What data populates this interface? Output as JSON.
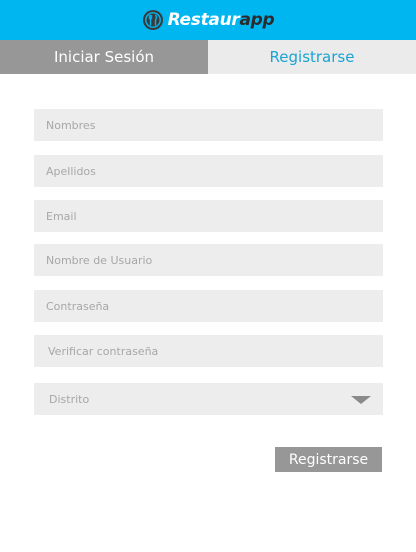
{
  "header": {
    "logo_part1": "Restaur",
    "logo_part2": "app",
    "background_color": "#00b6f1",
    "logo_icon": "fork-knife-plate-icon"
  },
  "tabs": [
    {
      "label": "Iniciar Sesión",
      "active": false
    },
    {
      "label": "Registrarse",
      "active": true
    }
  ],
  "form": {
    "fields": [
      {
        "placeholder": "Nombres",
        "value": ""
      },
      {
        "placeholder": "Apellidos",
        "value": ""
      },
      {
        "placeholder": "Email",
        "value": ""
      },
      {
        "placeholder": "Nombre de Usuario",
        "value": ""
      },
      {
        "placeholder": "Contraseña",
        "value": ""
      },
      {
        "placeholder": "Verificar contraseña",
        "value": ""
      }
    ],
    "district": {
      "label": "Distrito",
      "icon": "chevron-down-icon"
    },
    "submit_label": "Registrarse"
  },
  "colors": {
    "accent": "#00b6f1",
    "tab_active_text": "#1aa3d4",
    "button_bg": "#979797",
    "field_bg": "#ededed"
  }
}
